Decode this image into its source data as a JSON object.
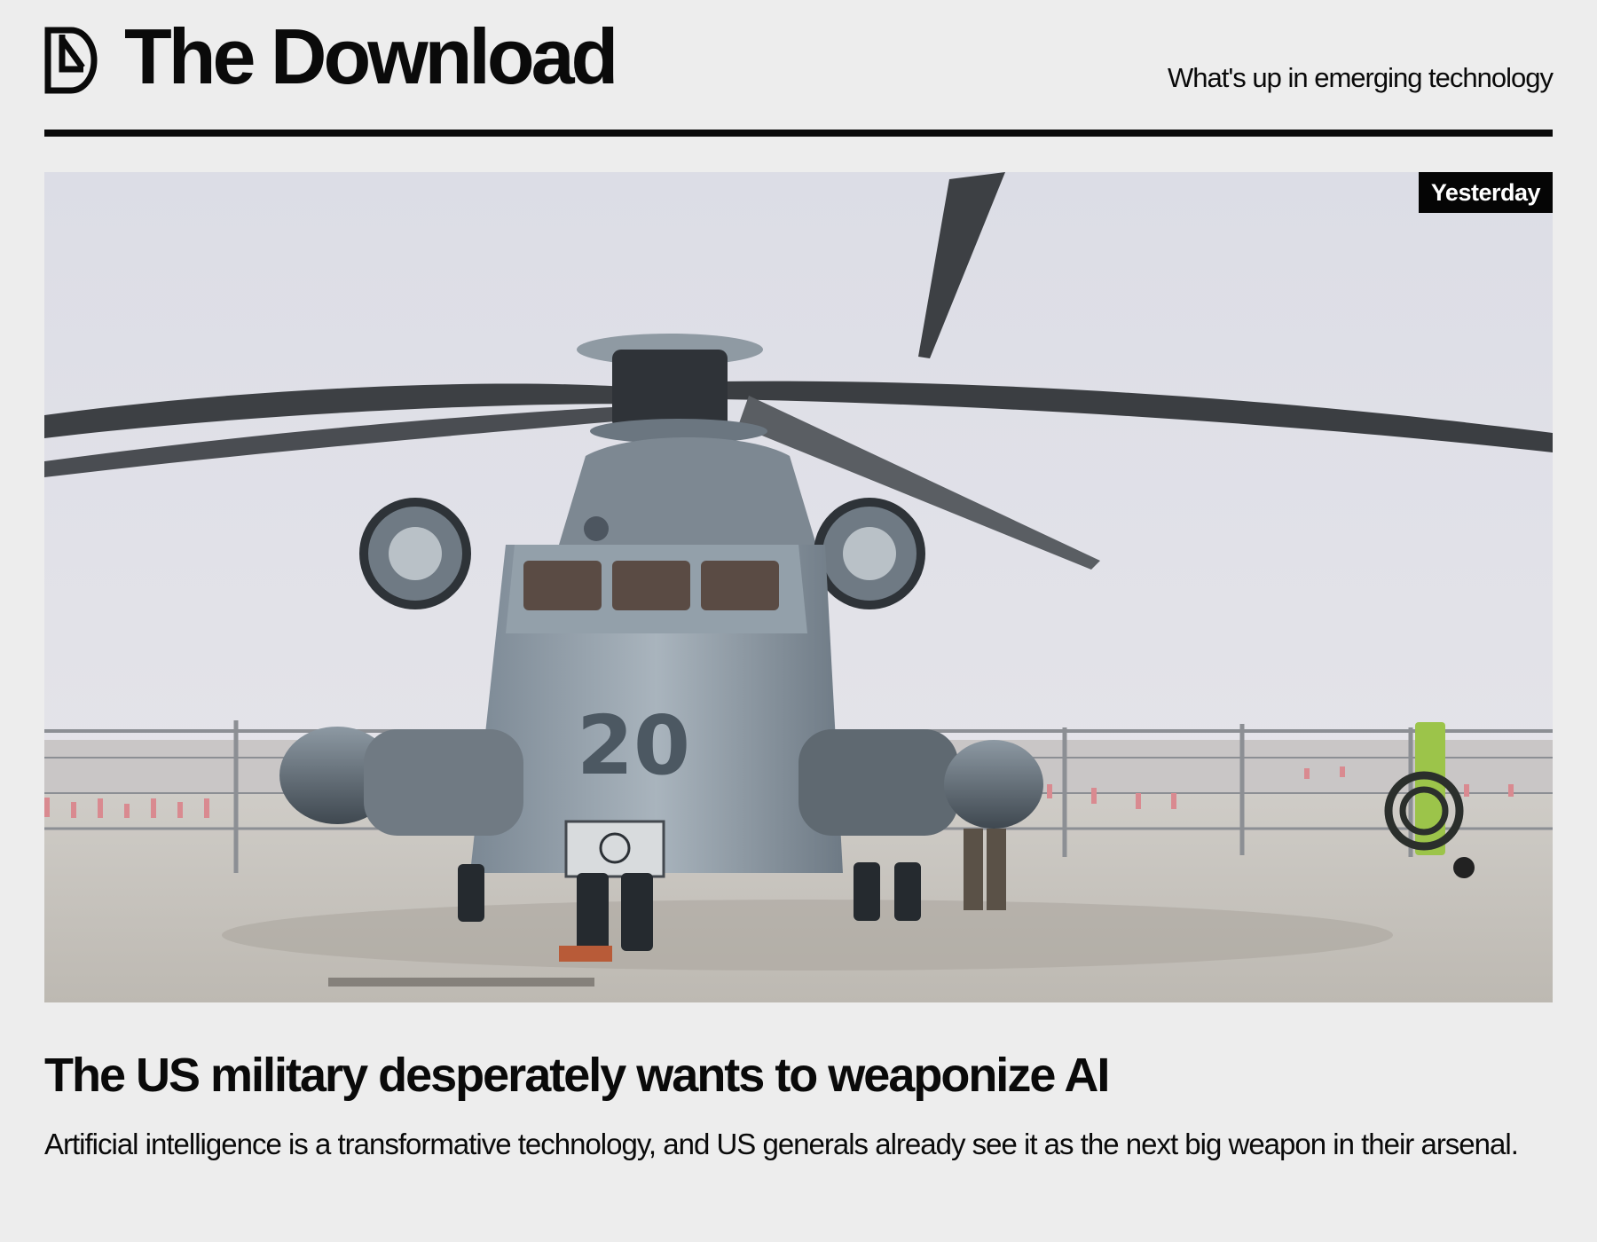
{
  "header": {
    "title": "The Download",
    "tagline": "What's up in emerging technology",
    "logo_icon": "download-monogram-icon"
  },
  "article": {
    "image": {
      "subject": "military-helicopter-photo",
      "tail_number": "20",
      "date_badge": "Yesterday"
    },
    "headline": "The US military desperately wants to weaponize AI",
    "dek": "Artificial intelligence is a transformative technology, and US generals already see it as the next big weapon in their arsenal."
  },
  "colors": {
    "background": "#ededed",
    "text": "#0a0a0a",
    "badge_background": "#050505",
    "badge_text": "#ffffff"
  }
}
